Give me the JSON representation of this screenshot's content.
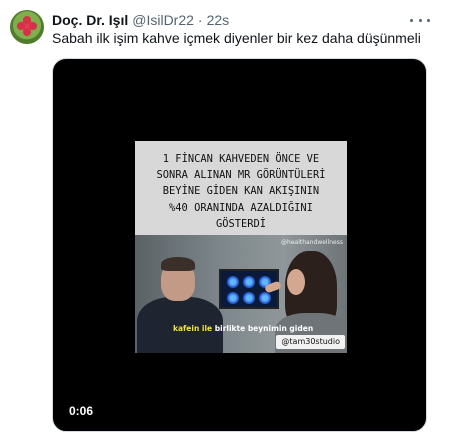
{
  "tweet": {
    "author_name": "Doç. Dr. Işıl",
    "handle": "@IsilDr22",
    "separator": "·",
    "time": "22s",
    "text": "Sabah ilk işim kahve içmek diyenler bir kez daha düşünmeli"
  },
  "video": {
    "caption_lines": [
      "1 FİNCAN KAHVEDEN ÖNCE VE",
      "SONRA ALINAN MR GÖRÜNTÜLERİ",
      "BEYİNE GİDEN KAN AKIŞININ",
      "%40 ORANINDA AZALDIĞINI",
      "GÖSTERDİ"
    ],
    "top_watermark": "@healthandwellness",
    "subtitle_prefix": "kafein ile",
    "subtitle_middle": " birlikte beynimi",
    "subtitle_suffix": "n giden",
    "studio_tag": "@tam30studio",
    "duration": "0:06"
  },
  "icons": {
    "more": "more-horizontal-icon",
    "avatar": "flower-avatar"
  }
}
